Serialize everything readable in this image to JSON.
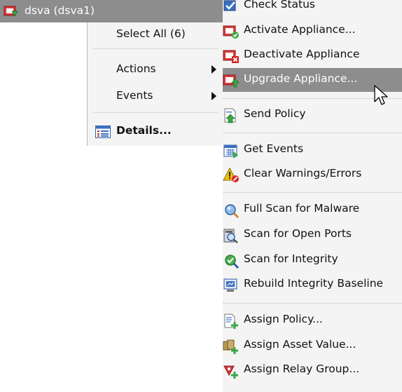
{
  "tree": {
    "node_label": "dsva (dsva1)",
    "icon": "appliance-node-icon"
  },
  "context_menu": {
    "select_all": "Select All (6)",
    "actions": "Actions",
    "events": "Events",
    "details": "Details..."
  },
  "actions_submenu": {
    "items": [
      {
        "label": "Check Status",
        "icon": "check-status-icon"
      },
      {
        "label": "Activate Appliance...",
        "icon": "activate-appliance-icon"
      },
      {
        "label": "Deactivate Appliance",
        "icon": "deactivate-appliance-icon"
      },
      {
        "label": "Upgrade Appliance...",
        "icon": "upgrade-appliance-icon",
        "highlighted": true
      },
      {
        "label": "Send Policy",
        "icon": "send-policy-icon"
      },
      {
        "label": "Get Events",
        "icon": "get-events-icon"
      },
      {
        "label": "Clear Warnings/Errors",
        "icon": "warning-icon"
      },
      {
        "label": "Full Scan for Malware",
        "icon": "malware-scan-icon"
      },
      {
        "label": "Scan for Open Ports",
        "icon": "port-scan-icon"
      },
      {
        "label": "Scan for Integrity",
        "icon": "integrity-scan-icon"
      },
      {
        "label": "Rebuild Integrity Baseline",
        "icon": "baseline-icon"
      },
      {
        "label": "Assign Policy...",
        "icon": "assign-policy-icon"
      },
      {
        "label": "Assign Asset Value...",
        "icon": "asset-value-icon"
      },
      {
        "label": "Assign Relay Group...",
        "icon": "relay-group-icon"
      }
    ]
  },
  "colors": {
    "highlight": "#8d8d8d",
    "menu_bg": "#f4f4f4"
  }
}
